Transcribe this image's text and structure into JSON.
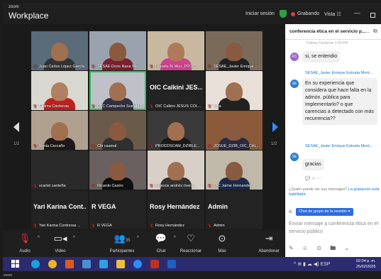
{
  "window": {
    "brand_small": "zoom",
    "brand": "Workplace",
    "sign_in": "Iniciar sesión",
    "recording": "Grabando",
    "view": "Vista",
    "view_icon": "grid-icon"
  },
  "colors": {
    "accent_blue": "#2e8cff",
    "recording_red": "#e03b3b",
    "active_speaker": "#29c15a",
    "taskbar": "#2c2b6e"
  },
  "grid": {
    "page_left": "1/2",
    "page_right": "1/2",
    "tiles": [
      {
        "name": "Juan Carlos López García",
        "bg": "#5a6b7a",
        "skin": "#a07050",
        "shirt": "#333"
      },
      {
        "name": "SESAE-Doris Iliana Mo...",
        "bg": "#9aa3ad",
        "skin": "#8a5a40",
        "shirt": "#7a2030"
      },
      {
        "name": "Hypatia Bi Moo_PROC...",
        "bg": "#c8b8a0",
        "skin": "#b07a5a",
        "shirt": "#d04090"
      },
      {
        "name": "SESAE_Javier Enrique ...",
        "bg": "#7a6a5a",
        "skin": "#8a5a40",
        "shirt": "#222"
      },
      {
        "name": "Fatima Cárdenas",
        "bg": "#d8d8d0",
        "skin": "#b08060",
        "shirt": "#c02020"
      },
      {
        "name": "CFC Campeche Sustain Pri",
        "bg": "#c0c0c8",
        "skin": "#a07050",
        "shirt": "#303040",
        "active": true
      },
      {
        "name": "OIC Calkini JESUS COL...",
        "bg": "#232323",
        "big": "OIC Calkini JES...",
        "textonly": true
      },
      {
        "name": "rosa",
        "bg": "#e8e0d8",
        "skin": "#a07050",
        "shirt": "#222"
      },
      {
        "name": "Sonia Carcaño",
        "bg": "#b0a090",
        "skin": "#a07050",
        "shirt": "#201818"
      },
      {
        "name": "Chi caamal",
        "bg": "#6a5a4a",
        "skin": "#8a5a40",
        "shirt": "#303030"
      },
      {
        "name": "PROCDSCAM_DZIBLE...",
        "bg": "#3a3a3a",
        "skin": "#a07050",
        "shirt": "#1a1a1a"
      },
      {
        "name": "JOSUE_DZIB_OIC_CAL...",
        "bg": "#8a5a3a",
        "skin": "#8a5a40",
        "shirt": "#2a2a40"
      },
      {
        "name": "scarlet cardeña",
        "bg": "#2a2a2a",
        "skin": "#2a2a2a",
        "shirt": "#2a2a2a"
      },
      {
        "name": "Ricardo Castro",
        "bg": "#6a6060",
        "skin": "#8a5a40",
        "shirt": "#101010"
      },
      {
        "name": "lic jesús andrés rivera...",
        "bg": "#d8d0c8",
        "skin": "#a07050",
        "shirt": "#303030"
      },
      {
        "name": "OIC Jaime Hernandez",
        "bg": "#c0b8a8",
        "skin": "#8a5a40",
        "shirt": "#1a2a4a"
      },
      {
        "name": "Yari Karina Contreras ...",
        "bg": "#232323",
        "big": "Yari Karina Cont...",
        "textonly": true
      },
      {
        "name": "R VEGA",
        "bg": "#232323",
        "big": "R VEGA",
        "textonly": true
      },
      {
        "name": "Rosy Hernández",
        "bg": "#232323",
        "big": "Rosy Hernández",
        "textonly": true
      },
      {
        "name": "Admin",
        "bg": "#232323",
        "big": "Admin",
        "textonly": true
      }
    ]
  },
  "toolbar": {
    "audio": "Audio",
    "video": "Video",
    "participants": "Participantes",
    "participants_count": "35",
    "chat": "Chat",
    "react": "Reaccionar",
    "more": "Más",
    "leave": "Abandonar"
  },
  "chat": {
    "title": "conferencia ética en el servicio p...",
    "more": "...",
    "faded": "Fátima Cárdenas 1:04 PM",
    "messages": [
      {
        "avatar": "FC",
        "avatar_color": "#9a6ad0",
        "sender": "",
        "text": "si, se entendio"
      },
      {
        "avatar": "SE",
        "avatar_color": "#2e7fd0",
        "sender": "SESAE_Javier Enrique Estrada Mont...",
        "text": "En su experiencia que considera que hace falta en la admón. pública para implementarlo? o que carencias a detectado con más recurrencia??"
      },
      {
        "avatar": "SE",
        "avatar_color": "#2e7fd0",
        "sender": "SESAE_Javier Enrique Estrada Mont...",
        "text": "gracias"
      }
    ],
    "hint_prefix": "¿Quién puede ver sus mensajes? ",
    "hint_link": "La grabación está habilitada",
    "to_label": "A:",
    "to_value": "Chat de grupo de la reunión",
    "input_placeholder": "Enviar mensaje a conferencia ética en el servicio público"
  },
  "taskbar": {
    "lang": "ESP",
    "time": "02:04 p. m.",
    "date": "25/02/2025"
  },
  "footer": "zoom"
}
